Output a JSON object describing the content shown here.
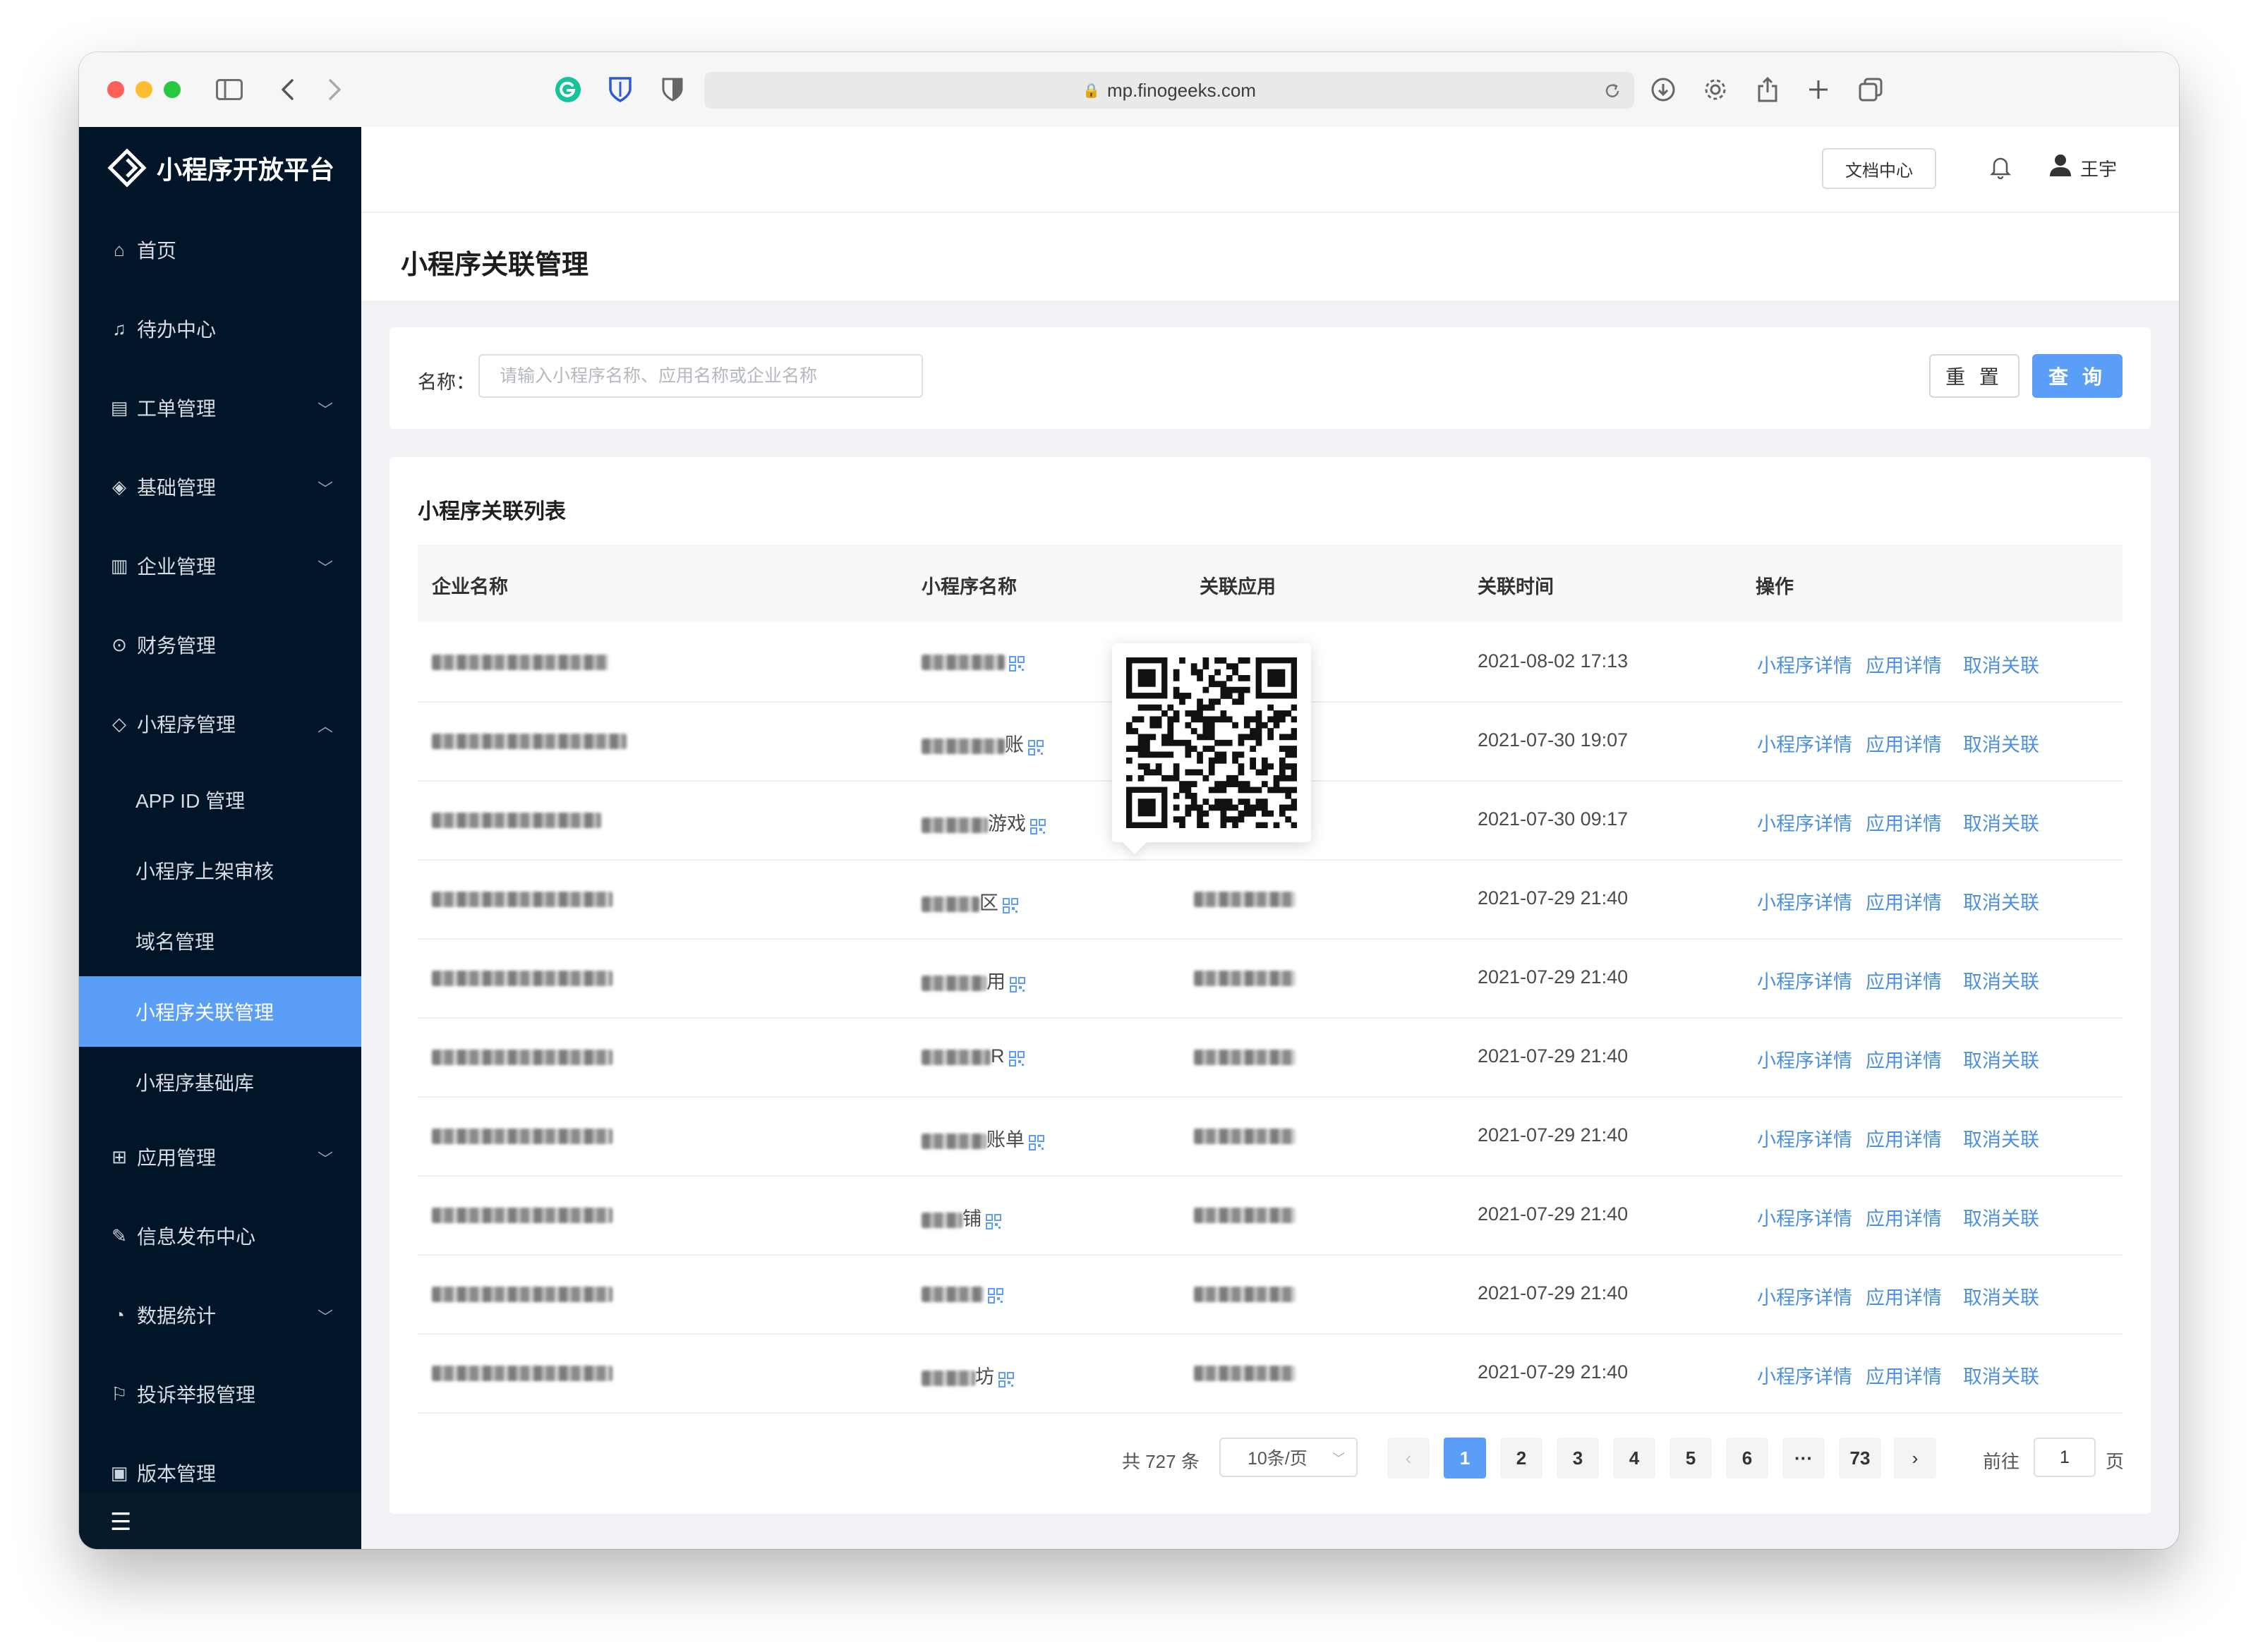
{
  "browser": {
    "url": "mp.finogeeks.com"
  },
  "app": {
    "logo_text": "小程序开放平台"
  },
  "sidebar": {
    "items": [
      {
        "label": "首页",
        "icon": "home-icon",
        "expandable": false
      },
      {
        "label": "待办中心",
        "icon": "bell-icon",
        "expandable": false
      },
      {
        "label": "工单管理",
        "icon": "ticket-icon",
        "expandable": true
      },
      {
        "label": "基础管理",
        "icon": "layers-icon",
        "expandable": true
      },
      {
        "label": "企业管理",
        "icon": "building-icon",
        "expandable": true
      },
      {
        "label": "财务管理",
        "icon": "finance-icon",
        "expandable": false
      },
      {
        "label": "小程序管理",
        "icon": "diamond-icon",
        "expandable": true,
        "expanded": true
      }
    ],
    "sub_items": [
      {
        "label": "APP ID 管理",
        "active": false
      },
      {
        "label": "小程序上架审核",
        "active": false
      },
      {
        "label": "域名管理",
        "active": false
      },
      {
        "label": "小程序关联管理",
        "active": true
      },
      {
        "label": "小程序基础库",
        "active": false
      }
    ],
    "items_after": [
      {
        "label": "应用管理",
        "icon": "grid-icon",
        "expandable": true
      },
      {
        "label": "信息发布中心",
        "icon": "edit-icon",
        "expandable": false
      },
      {
        "label": "数据统计",
        "icon": "chart-icon",
        "expandable": true
      },
      {
        "label": "投诉举报管理",
        "icon": "report-icon",
        "expandable": false
      },
      {
        "label": "版本管理",
        "icon": "version-icon",
        "expandable": false
      }
    ]
  },
  "header": {
    "doc_center": "文档中心",
    "user_name": "王宇"
  },
  "page": {
    "title": "小程序关联管理"
  },
  "search": {
    "label": "名称：",
    "placeholder": "请输入小程序名称、应用名称或企业名称",
    "reset_label": "重 置",
    "query_label": "查 询"
  },
  "list": {
    "title": "小程序关联列表",
    "columns": [
      "企业名称",
      "小程序名称",
      "关联应用",
      "关联时间",
      "操作"
    ],
    "actions": [
      "小程序详情",
      "应用详情",
      "取消关联"
    ],
    "rows": [
      {
        "mp_suffix": "",
        "time": "2021-08-02 17:13"
      },
      {
        "mp_suffix": "账",
        "time": "2021-07-30 19:07"
      },
      {
        "mp_suffix": "游戏",
        "time": "2021-07-30 09:17"
      },
      {
        "mp_suffix": "区",
        "time": "2021-07-29 21:40"
      },
      {
        "mp_suffix": "用",
        "time": "2021-07-29 21:40"
      },
      {
        "mp_suffix": "R",
        "time": "2021-07-29 21:40"
      },
      {
        "mp_suffix": "账单",
        "time": "2021-07-29 21:40"
      },
      {
        "mp_suffix": "铺",
        "time": "2021-07-29 21:40"
      },
      {
        "mp_suffix": "",
        "time": "2021-07-29 21:40"
      },
      {
        "mp_suffix": "坊",
        "time": "2021-07-29 21:40"
      }
    ]
  },
  "pagination": {
    "total_text": "共 727 条",
    "page_size": "10条/页",
    "pages": [
      "1",
      "2",
      "3",
      "4",
      "5",
      "6",
      "···",
      "73"
    ],
    "current_page": "1",
    "goto_label": "前往",
    "goto_value": "1",
    "goto_unit": "页"
  },
  "colors": {
    "sidebar_bg": "#011529",
    "accent": "#5b9ef7",
    "link": "#4a90e2"
  }
}
